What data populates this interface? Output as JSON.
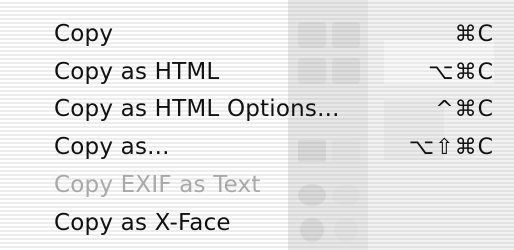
{
  "menu": {
    "items": [
      {
        "label": "Copy",
        "shortcut": "⌘C",
        "enabled": true
      },
      {
        "label": "Copy as HTML",
        "shortcut": "⌥⌘C",
        "enabled": true
      },
      {
        "label": "Copy as HTML Options...",
        "shortcut": "^⌘C",
        "enabled": true
      },
      {
        "label": "Copy as...",
        "shortcut": "⌥⇧⌘C",
        "enabled": true
      },
      {
        "label": "Copy EXIF as Text",
        "shortcut": "",
        "enabled": false
      },
      {
        "label": "Copy as X-Face",
        "shortcut": "",
        "enabled": true
      }
    ]
  },
  "colors": {
    "text": "#111111",
    "disabled_text": "#a9a9a9",
    "background": "#f3f3f3"
  }
}
